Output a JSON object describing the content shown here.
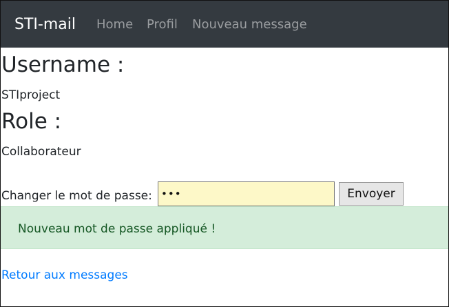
{
  "navbar": {
    "brand": "STI-mail",
    "links": [
      "Home",
      "Profil",
      "Nouveau message"
    ]
  },
  "profile": {
    "username_heading": "Username :",
    "username_value": "STIproject",
    "role_heading": "Role :",
    "role_value": "Collaborateur"
  },
  "password_form": {
    "label": "Changer le mot de passe:",
    "value": "abc",
    "submit_label": "Envoyer"
  },
  "alert": {
    "message": "Nouveau mot de passe appliqué !"
  },
  "footer": {
    "back_link": "Retour aux messages"
  },
  "colors": {
    "navbar_bg": "#343a40",
    "alert_bg": "#d4edda",
    "alert_text": "#155724",
    "link": "#007bff",
    "input_bg": "#fdf8c8"
  }
}
